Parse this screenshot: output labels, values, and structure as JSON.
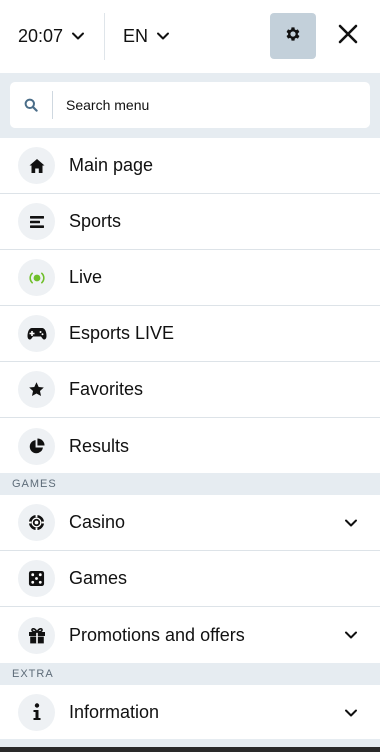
{
  "header": {
    "time": "20:07",
    "language": "EN",
    "settings_icon": "gear-icon",
    "close_icon": "close-icon"
  },
  "search": {
    "placeholder": "Search menu",
    "value": ""
  },
  "main_menu": [
    {
      "label": "Main page",
      "icon": "home-icon"
    },
    {
      "label": "Sports",
      "icon": "list-icon"
    },
    {
      "label": "Live",
      "icon": "live-broadcast-icon"
    },
    {
      "label": "Esports LIVE",
      "icon": "gamepad-icon"
    },
    {
      "label": "Favorites",
      "icon": "star-icon"
    },
    {
      "label": "Results",
      "icon": "pie-chart-icon"
    }
  ],
  "games_section": {
    "title": "GAMES",
    "items": [
      {
        "label": "Casino",
        "icon": "casino-chip-icon",
        "expandable": true
      },
      {
        "label": "Games",
        "icon": "dice-icon",
        "expandable": false
      },
      {
        "label": "Promotions and offers",
        "icon": "gift-icon",
        "expandable": true
      }
    ]
  },
  "extra_section": {
    "title": "EXTRA",
    "items": [
      {
        "label": "Information",
        "icon": "info-icon",
        "expandable": true
      }
    ]
  },
  "colors": {
    "background": "#e6ecf1",
    "settings_button": "#c3d0da",
    "icon_circle": "#eef1f4",
    "live_green": "#6fbf2a",
    "search_icon": "#4a6d88"
  }
}
